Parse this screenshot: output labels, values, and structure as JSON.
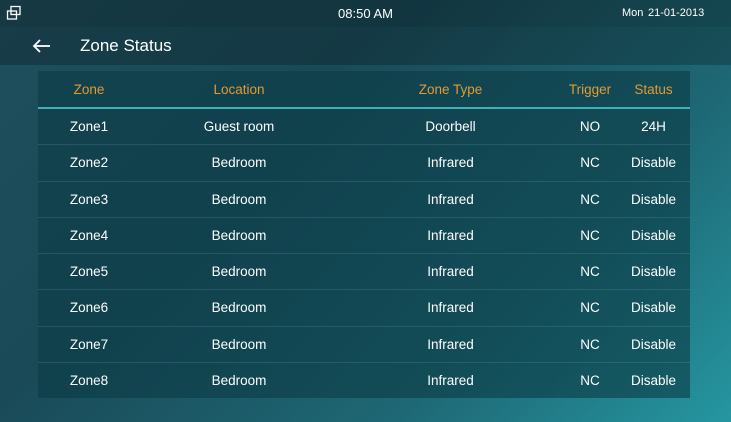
{
  "status_bar": {
    "time": "08:50 AM",
    "day": "Mon",
    "date": "21-01-2013"
  },
  "header": {
    "title": "Zone Status",
    "back_icon": "arrow-left-icon"
  },
  "table": {
    "columns": [
      "Zone",
      "Location",
      "Zone Type",
      "Trigger",
      "Status"
    ],
    "rows": [
      [
        "Zone1",
        "Guest room",
        "Doorbell",
        "NO",
        "24H"
      ],
      [
        "Zone2",
        "Bedroom",
        "Infrared",
        "NC",
        "Disable"
      ],
      [
        "Zone3",
        "Bedroom",
        "Infrared",
        "NC",
        "Disable"
      ],
      [
        "Zone4",
        "Bedroom",
        "Infrared",
        "NC",
        "Disable"
      ],
      [
        "Zone5",
        "Bedroom",
        "Infrared",
        "NC",
        "Disable"
      ],
      [
        "Zone6",
        "Bedroom",
        "Infrared",
        "NC",
        "Disable"
      ],
      [
        "Zone7",
        "Bedroom",
        "Infrared",
        "NC",
        "Disable"
      ],
      [
        "Zone8",
        "Bedroom",
        "Infrared",
        "NC",
        "Disable"
      ]
    ]
  },
  "colors": {
    "header_text": "#e39a34",
    "header_rule": "#43aeb8",
    "cell_text": "#ffffff"
  }
}
